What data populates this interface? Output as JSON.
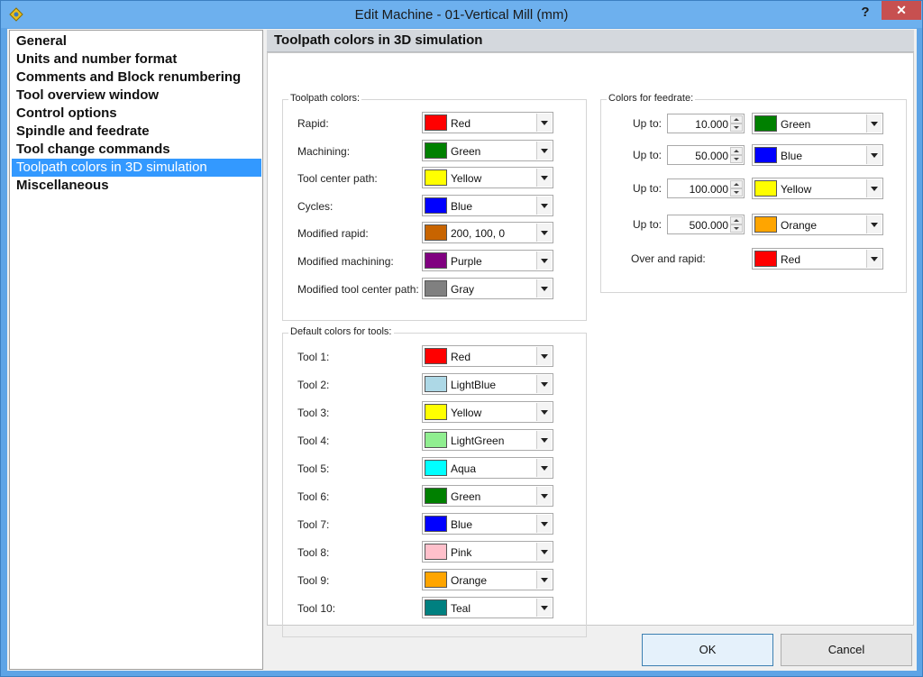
{
  "window": {
    "title": "Edit Machine - 01-Vertical Mill (mm)",
    "help_label": "?",
    "close_label": "✕"
  },
  "nav": {
    "items": [
      {
        "label": "General"
      },
      {
        "label": "Units and number format"
      },
      {
        "label": "Comments and Block renumbering"
      },
      {
        "label": "Tool overview window"
      },
      {
        "label": "Control options"
      },
      {
        "label": "Spindle and feedrate"
      },
      {
        "label": "Tool change commands"
      },
      {
        "label": "Toolpath colors in 3D simulation",
        "selected": true
      },
      {
        "label": "Miscellaneous"
      }
    ]
  },
  "panel": {
    "title": "Toolpath colors in 3D simulation"
  },
  "toolpath_colors": {
    "legend": "Toolpath colors:",
    "rows": [
      {
        "label": "Rapid:",
        "value": "Red",
        "color": "#ff0000"
      },
      {
        "label": "Machining:",
        "value": "Green",
        "color": "#008000"
      },
      {
        "label": "Tool center path:",
        "value": "Yellow",
        "color": "#ffff00"
      },
      {
        "label": "Cycles:",
        "value": "Blue",
        "color": "#0000ff"
      },
      {
        "label": "Modified rapid:",
        "value": "200, 100, 0",
        "color": "#c86400"
      },
      {
        "label": "Modified machining:",
        "value": "Purple",
        "color": "#800080"
      },
      {
        "label": "Modified tool center path:",
        "value": "Gray",
        "color": "#808080"
      }
    ]
  },
  "tool_colors": {
    "legend": "Default colors for tools:",
    "rows": [
      {
        "label": "Tool 1:",
        "value": "Red",
        "color": "#ff0000"
      },
      {
        "label": "Tool 2:",
        "value": "LightBlue",
        "color": "#add8e6"
      },
      {
        "label": "Tool 3:",
        "value": "Yellow",
        "color": "#ffff00"
      },
      {
        "label": "Tool 4:",
        "value": "LightGreen",
        "color": "#90ee90"
      },
      {
        "label": "Tool 5:",
        "value": "Aqua",
        "color": "#00ffff"
      },
      {
        "label": "Tool 6:",
        "value": "Green",
        "color": "#008000"
      },
      {
        "label": "Tool 7:",
        "value": "Blue",
        "color": "#0000ff"
      },
      {
        "label": "Tool 8:",
        "value": "Pink",
        "color": "#ffc0cb"
      },
      {
        "label": "Tool 9:",
        "value": "Orange",
        "color": "#ffa500"
      },
      {
        "label": "Tool 10:",
        "value": "Teal",
        "color": "#008080"
      }
    ]
  },
  "feedrate_colors": {
    "legend": "Colors for feedrate:",
    "rows": [
      {
        "label": "Up to:",
        "amount": "10.000",
        "value": "Green",
        "color": "#008000"
      },
      {
        "label": "Up to:",
        "amount": "50.000",
        "value": "Blue",
        "color": "#0000ff"
      },
      {
        "label": "Up to:",
        "amount": "100.000",
        "value": "Yellow",
        "color": "#ffff00"
      },
      {
        "label": "Up to:",
        "amount": "500.000",
        "value": "Orange",
        "color": "#ffa500"
      }
    ],
    "over": {
      "label": "Over and rapid:",
      "value": "Red",
      "color": "#ff0000"
    }
  },
  "buttons": {
    "ok": "OK",
    "cancel": "Cancel"
  }
}
